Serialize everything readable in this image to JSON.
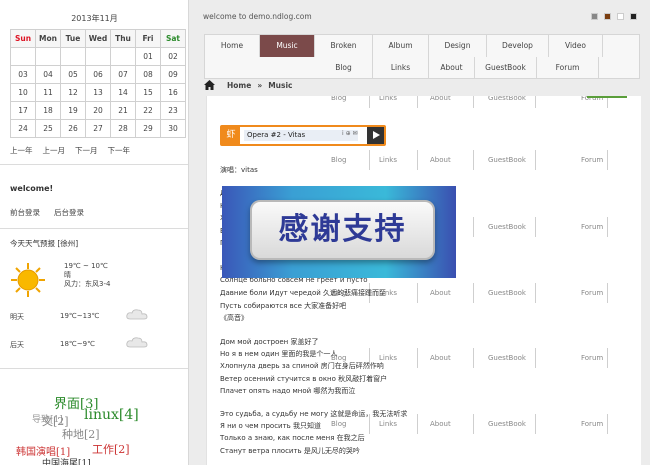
{
  "calendar": {
    "caption": "2013年11月",
    "headers": [
      "Sun",
      "Mon",
      "Tue",
      "Wed",
      "Thu",
      "Fri",
      "Sat"
    ],
    "weeks": [
      [
        "",
        "",
        "",
        "",
        "",
        "01",
        "02"
      ],
      [
        "03",
        "04",
        "05",
        "06",
        "07",
        "08",
        "09"
      ],
      [
        "10",
        "11",
        "12",
        "13",
        "14",
        "15",
        "16"
      ],
      [
        "17",
        "18",
        "19",
        "20",
        "21",
        "22",
        "23"
      ],
      [
        "24",
        "25",
        "26",
        "27",
        "28",
        "29",
        "30"
      ]
    ],
    "nav": [
      "上一年",
      "上一月",
      "下一月",
      "下一年"
    ]
  },
  "welcome": {
    "title": "welcome!",
    "links": [
      "前台登录",
      "后台登录"
    ]
  },
  "weather": {
    "title": "今天天气预报 [徐州]",
    "icon": "sun-icon",
    "today": [
      "19℃ ~ 10℃",
      "晴",
      "风力：东风3-4"
    ],
    "tomorrow": {
      "day": "明天",
      "temp": "19℃~13℃",
      "icon": "cloud-icon"
    },
    "after": {
      "day": "后天",
      "temp": "18℃~9℃",
      "icon": "cloud-icon"
    }
  },
  "tags": [
    {
      "text": "界面[3]",
      "color": "#2a8a2a"
    },
    {
      "text": "linux[4]",
      "color": "#2a8a2a"
    },
    {
      "text": "导致[1]",
      "color": "#999999"
    },
    {
      "text": "文[2]",
      "color": "#888888"
    },
    {
      "text": "种地[2]",
      "color": "#888888"
    },
    {
      "text": "韩国演唱[1]",
      "color": "#cc3333"
    },
    {
      "text": "工作[2]",
      "color": "#cc3333"
    },
    {
      "text": "中国海尾[1]",
      "color": "#333333"
    }
  ],
  "topbar": {
    "welcome_text": "welcome to demo.ndlog.com",
    "swatches": [
      "#888888",
      "#7b3e10",
      "#ffffff",
      "#222222"
    ]
  },
  "nav": {
    "row1": [
      "Home",
      "Music",
      "Broken",
      "Album",
      "Design",
      "Develop",
      "Video"
    ],
    "row2": [
      "Blog",
      "Links",
      "About",
      "GuestBook",
      "Forum"
    ],
    "active": "Music"
  },
  "breadcrumb": {
    "home": "Home",
    "separator": "»",
    "current": "Music"
  },
  "ghost_menu": [
    "Blog",
    "Links",
    "About",
    "GuestBook",
    "Forum"
  ],
  "player": {
    "logo": "虾",
    "track": "Opera #2 - Vitas",
    "icons": "i ⊕ ✉"
  },
  "lyrics": {
    "singer": "演唱：vitas",
    "lines1": [
      "Д",
      "Н",
      "Х",
      "В",
      "П"
    ],
    "lines2": [
      "Н",
      "Солнце больно совсем не греет и пусто",
      "Давние боли Идут чередой 久远的悲痛接踵而至",
      "Пусть собираются все 大家准备好吧",
      "《高音》"
    ],
    "lines3": [
      "Дом мой достроен 家盖好了",
      "Но я в нем один 里面的我是个一人",
      "Хлопнула дверь за спиной 房门在身后砰然作响",
      "Ветер осенний стучится в окно 秋风敲打着窗户",
      "Плачет опять надо мной 哪然为我而泣"
    ],
    "lines4": [
      "Это судьба, а судьбу не могу 这就是命运，我无法听求",
      "Я ни о чем просить 我只知道",
      "Только а знаю, как после меня 在我之后",
      "Станут ветра плосить 是风儿无尽的哭吟"
    ]
  },
  "banner": {
    "text": "感谢支持"
  }
}
